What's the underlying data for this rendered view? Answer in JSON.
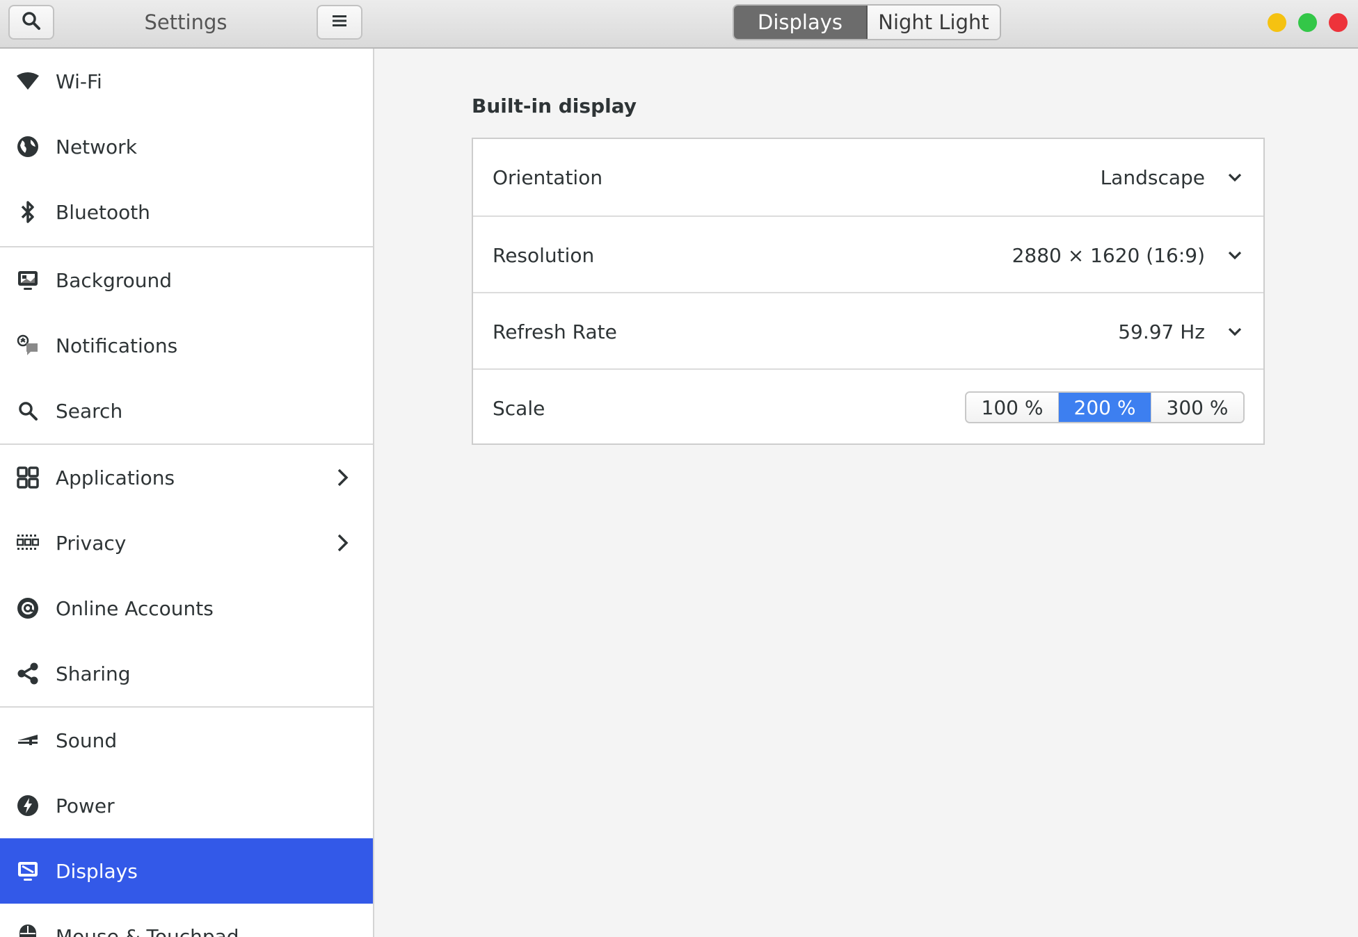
{
  "header": {
    "title": "Settings",
    "view_tabs": [
      {
        "label": "Displays",
        "active": true
      },
      {
        "label": "Night Light",
        "active": false
      }
    ],
    "window_controls": {
      "minimize_color": "#f5c211",
      "maximize_color": "#33c748",
      "close_color": "#ed333b"
    }
  },
  "sidebar": {
    "selected_color": "#3359e8",
    "items": [
      {
        "label": "Wi-Fi",
        "icon": "wifi-icon"
      },
      {
        "label": "Network",
        "icon": "globe-icon"
      },
      {
        "label": "Bluetooth",
        "icon": "bluetooth-icon"
      },
      {
        "label": "Background",
        "icon": "background-icon"
      },
      {
        "label": "Notifications",
        "icon": "notifications-icon"
      },
      {
        "label": "Search",
        "icon": "search-icon"
      },
      {
        "label": "Applications",
        "icon": "applications-icon",
        "has_submenu": true
      },
      {
        "label": "Privacy",
        "icon": "privacy-icon",
        "has_submenu": true
      },
      {
        "label": "Online Accounts",
        "icon": "at-sign-icon"
      },
      {
        "label": "Sharing",
        "icon": "share-icon"
      },
      {
        "label": "Sound",
        "icon": "sound-icon"
      },
      {
        "label": "Power",
        "icon": "power-icon"
      },
      {
        "label": "Displays",
        "icon": "display-icon",
        "selected": true
      },
      {
        "label": "Mouse & Touchpad",
        "icon": "mouse-icon"
      }
    ]
  },
  "main": {
    "section_title": "Built-in display",
    "rows": [
      {
        "label": "Orientation",
        "value": "Landscape"
      },
      {
        "label": "Resolution",
        "value": "2880 × 1620 (16:9)"
      },
      {
        "label": "Refresh Rate",
        "value": "59.97 Hz"
      },
      {
        "label": "Scale"
      }
    ],
    "scale_options": [
      {
        "label": "100 %",
        "active": false
      },
      {
        "label": "200 %",
        "active": true
      },
      {
        "label": "300 %",
        "active": false
      }
    ],
    "accent_color": "#3d7ff0"
  }
}
